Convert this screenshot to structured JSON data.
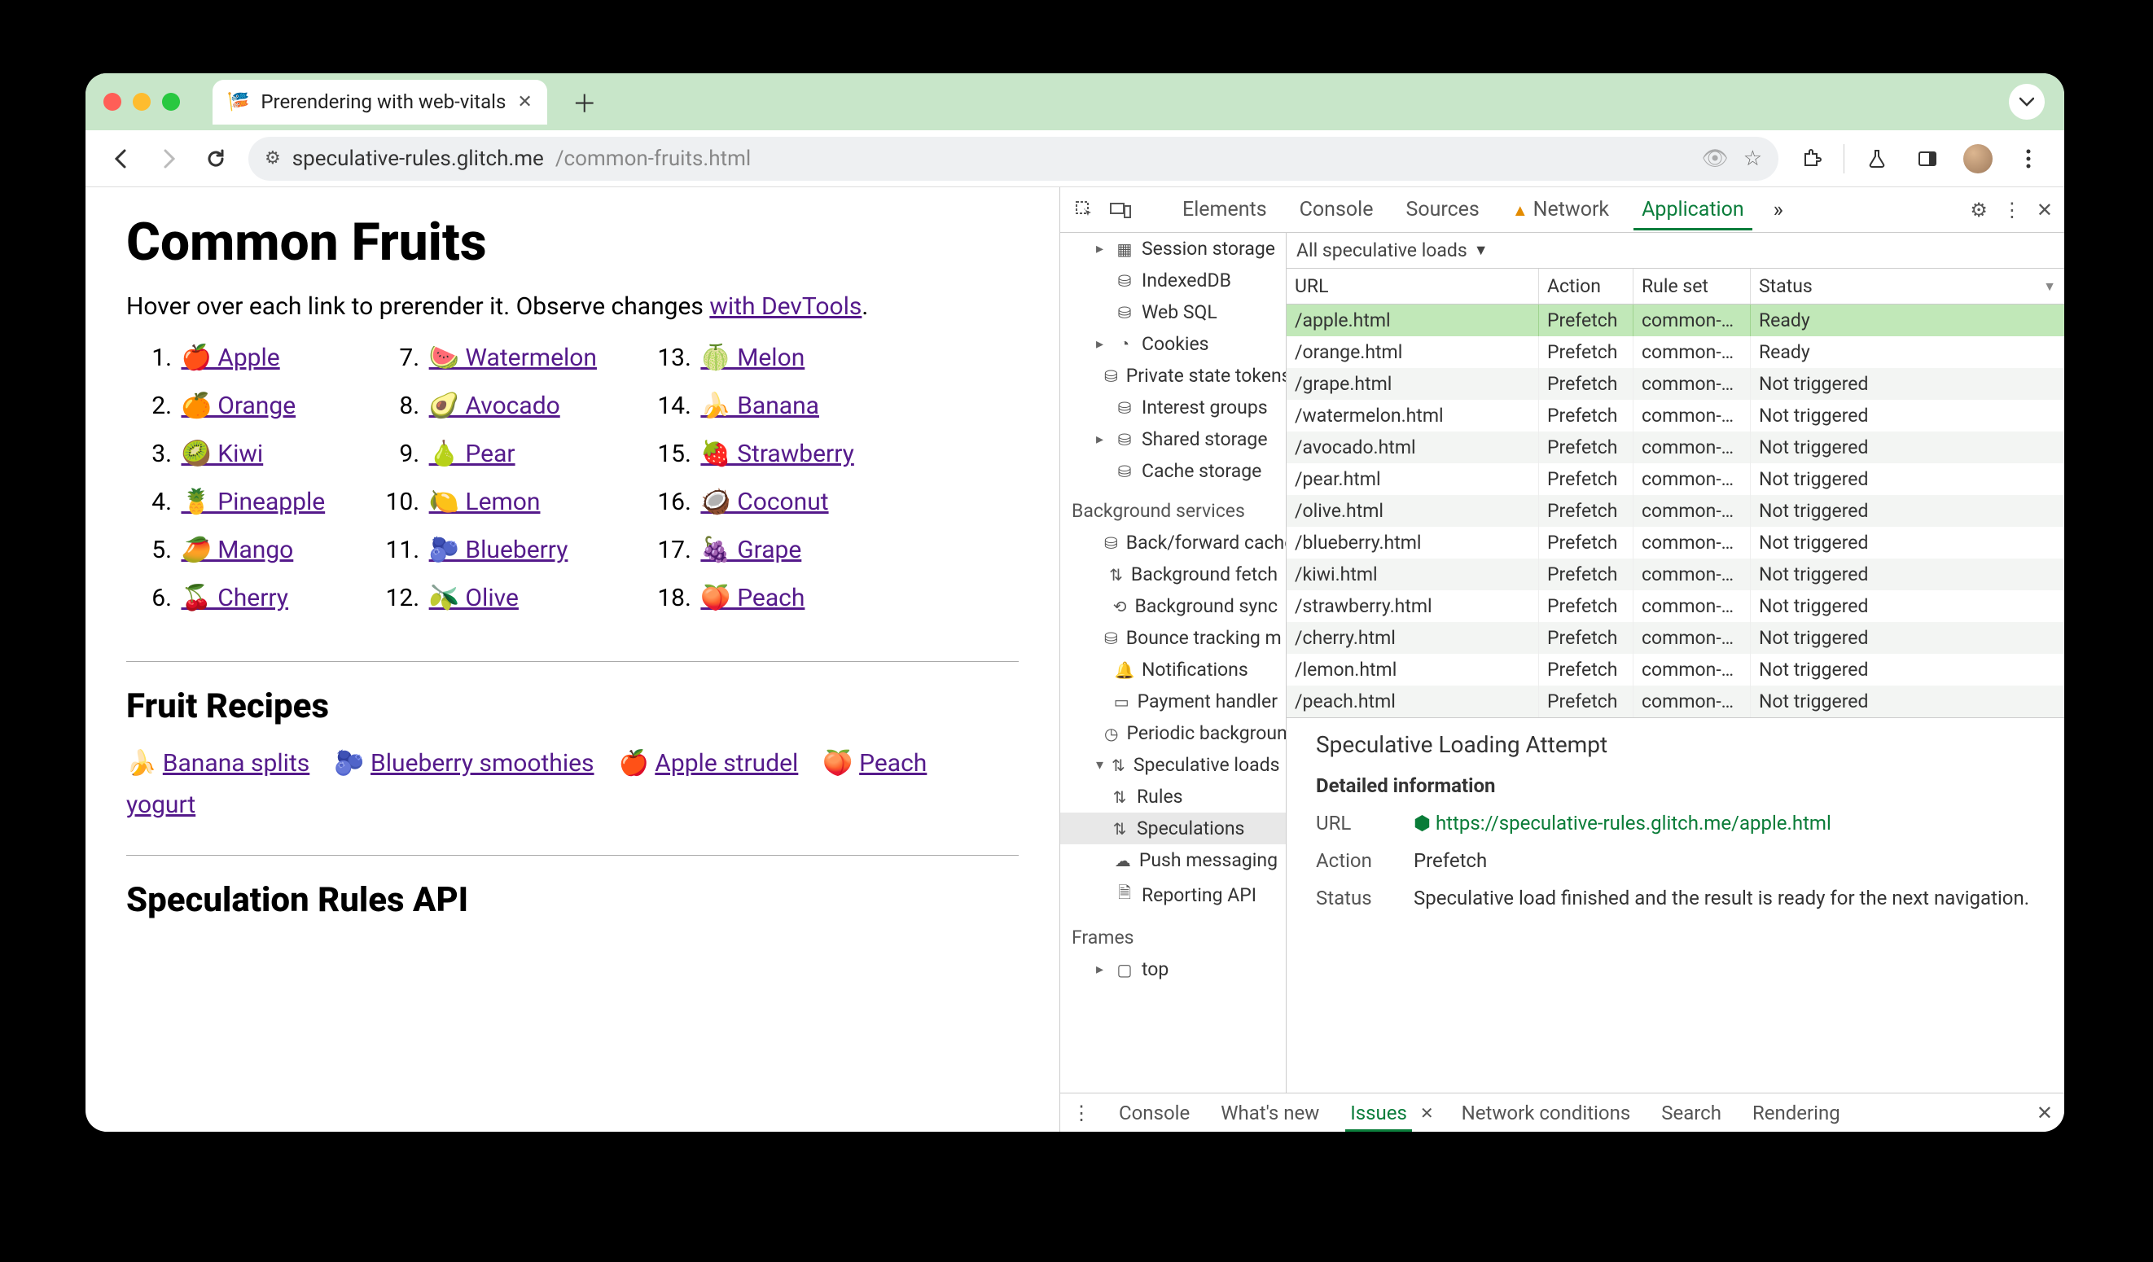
{
  "tab": {
    "title": "Prerendering with web-vitals"
  },
  "url": {
    "host": "speculative-rules.glitch.me",
    "path": "/common-fruits.html"
  },
  "page": {
    "h1": "Common Fruits",
    "intro_pre": "Hover over each link to prerender it. Observe changes ",
    "intro_link": "with DevTools",
    "intro_post": ".",
    "fruits": [
      {
        "n": "1.",
        "e": "🍎",
        "t": "Apple"
      },
      {
        "n": "2.",
        "e": "🍊",
        "t": "Orange"
      },
      {
        "n": "3.",
        "e": "🥝",
        "t": "Kiwi"
      },
      {
        "n": "4.",
        "e": "🍍",
        "t": "Pineapple"
      },
      {
        "n": "5.",
        "e": "🥭",
        "t": "Mango"
      },
      {
        "n": "6.",
        "e": "🍒",
        "t": "Cherry"
      },
      {
        "n": "7.",
        "e": "🍉",
        "t": "Watermelon"
      },
      {
        "n": "8.",
        "e": "🥑",
        "t": "Avocado"
      },
      {
        "n": "9.",
        "e": "🍐",
        "t": "Pear"
      },
      {
        "n": "10.",
        "e": "🍋",
        "t": "Lemon"
      },
      {
        "n": "11.",
        "e": "🫐",
        "t": "Blueberry"
      },
      {
        "n": "12.",
        "e": "🫒",
        "t": "Olive"
      },
      {
        "n": "13.",
        "e": "🍈",
        "t": "Melon"
      },
      {
        "n": "14.",
        "e": "🍌",
        "t": "Banana"
      },
      {
        "n": "15.",
        "e": "🍓",
        "t": "Strawberry"
      },
      {
        "n": "16.",
        "e": "🥥",
        "t": "Coconut"
      },
      {
        "n": "17.",
        "e": "🍇",
        "t": "Grape"
      },
      {
        "n": "18.",
        "e": "🍑",
        "t": "Peach"
      }
    ],
    "h2a": "Fruit Recipes",
    "recipes": [
      {
        "e": "🍌",
        "t": "Banana splits"
      },
      {
        "e": "🫐",
        "t": "Blueberry smoothies"
      },
      {
        "e": "🍎",
        "t": "Apple strudel"
      },
      {
        "e": "🍑",
        "t": "Peach yogurt"
      }
    ],
    "h2b": "Speculation Rules API"
  },
  "devtools": {
    "tabs": {
      "elements": "Elements",
      "console": "Console",
      "sources": "Sources",
      "network": "Network",
      "application": "Application"
    },
    "sidebar": {
      "session_storage": "Session storage",
      "indexeddb": "IndexedDB",
      "websql": "Web SQL",
      "cookies": "Cookies",
      "private_state_tokens": "Private state tokens",
      "interest_groups": "Interest groups",
      "shared_storage": "Shared storage",
      "cache_storage": "Cache storage",
      "bg_header": "Background services",
      "back_forward": "Back/forward cache",
      "bg_fetch": "Background fetch",
      "bg_sync": "Background sync",
      "bounce": "Bounce tracking m",
      "notifications": "Notifications",
      "payment": "Payment handler",
      "periodic": "Periodic background",
      "speculative": "Speculative loads",
      "rules": "Rules",
      "speculations": "Speculations",
      "push": "Push messaging",
      "reporting": "Reporting API",
      "frames_header": "Frames",
      "top": "top"
    },
    "filter_label": "All speculative loads",
    "columns": {
      "url": "URL",
      "action": "Action",
      "ruleset": "Rule set",
      "status": "Status"
    },
    "status_ready": "Ready",
    "status_nt": "Not triggered",
    "action_pf": "Prefetch",
    "ruleset_v": "common-…",
    "rows": [
      {
        "url": "/apple.html",
        "status": "Ready",
        "sel": true
      },
      {
        "url": "/orange.html",
        "status": "Ready"
      },
      {
        "url": "/grape.html",
        "status": "Not triggered"
      },
      {
        "url": "/watermelon.html",
        "status": "Not triggered"
      },
      {
        "url": "/avocado.html",
        "status": "Not triggered"
      },
      {
        "url": "/pear.html",
        "status": "Not triggered"
      },
      {
        "url": "/olive.html",
        "status": "Not triggered"
      },
      {
        "url": "/blueberry.html",
        "status": "Not triggered"
      },
      {
        "url": "/kiwi.html",
        "status": "Not triggered"
      },
      {
        "url": "/strawberry.html",
        "status": "Not triggered"
      },
      {
        "url": "/cherry.html",
        "status": "Not triggered"
      },
      {
        "url": "/lemon.html",
        "status": "Not triggered"
      },
      {
        "url": "/peach.html",
        "status": "Not triggered"
      }
    ],
    "detail": {
      "title": "Speculative Loading Attempt",
      "subtitle": "Detailed information",
      "url_k": "URL",
      "url_v": "https://speculative-rules.glitch.me/apple.html",
      "action_k": "Action",
      "action_v": "Prefetch",
      "status_k": "Status",
      "status_v": "Speculative load finished and the result is ready for the next navigation."
    },
    "drawer": {
      "console": "Console",
      "whatsnew": "What's new",
      "issues": "Issues",
      "netcond": "Network conditions",
      "search": "Search",
      "rendering": "Rendering"
    }
  }
}
